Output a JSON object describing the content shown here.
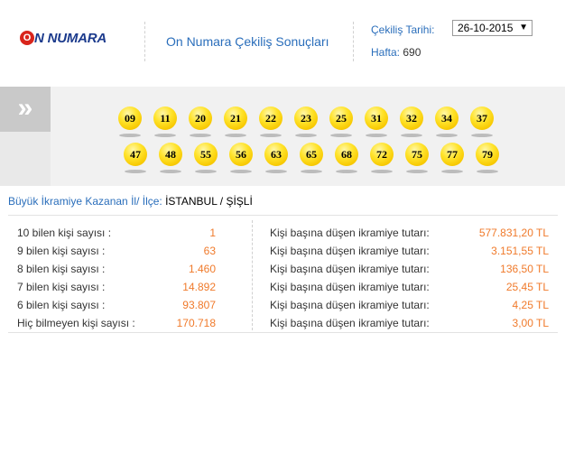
{
  "header": {
    "logo_letter": "O",
    "logo_text": "N NUMARA",
    "page_title": "On Numara Çekiliş Sonuçları",
    "date_label": "Çekiliş Tarihi:",
    "date_value": "26-10-2015",
    "week_label": "Hafta:",
    "week_value": "690"
  },
  "draw": {
    "row1": [
      "09",
      "11",
      "20",
      "21",
      "22",
      "23",
      "25",
      "31",
      "32",
      "34",
      "37"
    ],
    "row2": [
      "47",
      "48",
      "55",
      "56",
      "63",
      "65",
      "68",
      "72",
      "75",
      "77",
      "79"
    ]
  },
  "winner": {
    "label": "Büyük İkramiye Kazanan İl/ İlçe:",
    "value": "İSTANBUL / ŞİŞLİ"
  },
  "results": [
    {
      "label": "10 bilen kişi sayısı :",
      "count": "1",
      "prize_label": "Kişi başına düşen ikramiye tutarı:",
      "prize": "577.831,20 TL"
    },
    {
      "label": "9 bilen kişi sayısı :",
      "count": "63",
      "prize_label": "Kişi başına düşen ikramiye tutarı:",
      "prize": "3.151,55 TL"
    },
    {
      "label": "8 bilen kişi sayısı :",
      "count": "1.460",
      "prize_label": "Kişi başına düşen ikramiye tutarı:",
      "prize": "136,50 TL"
    },
    {
      "label": "7 bilen kişi sayısı :",
      "count": "14.892",
      "prize_label": "Kişi başına düşen ikramiye tutarı:",
      "prize": "25,45 TL"
    },
    {
      "label": "6 bilen kişi sayısı :",
      "count": "93.807",
      "prize_label": "Kişi başına düşen ikramiye tutarı:",
      "prize": "4,25 TL"
    },
    {
      "label": "Hiç bilmeyen kişi sayısı :",
      "count": "170.718",
      "prize_label": "Kişi başına düşen ikramiye tutarı:",
      "prize": "3,00 TL"
    }
  ],
  "icons": {
    "band_arrow": "double-chevron-right-icon",
    "select_arrow": "triangle-down-icon"
  },
  "colors": {
    "link_blue": "#2a6ebb",
    "value_orange": "#f07a2b",
    "ball_yellow": "#ffe32b"
  }
}
